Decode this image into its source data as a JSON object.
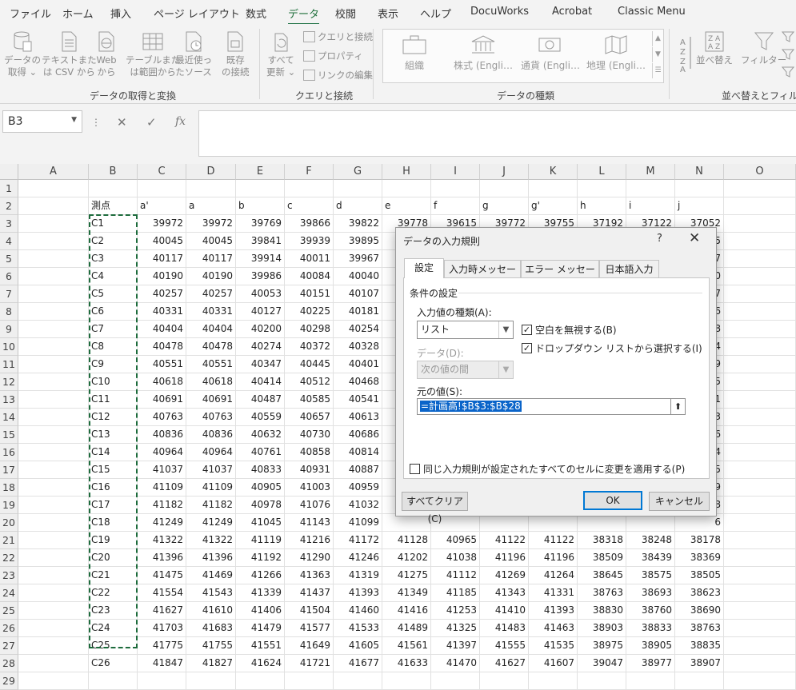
{
  "tabs": [
    "ファイル",
    "ホーム",
    "挿入",
    "ページ レイアウト",
    "数式",
    "データ",
    "校閲",
    "表示",
    "ヘルプ",
    "DocuWorks",
    "Acrobat",
    "Classic Menu"
  ],
  "ribbon": {
    "get_data": {
      "l1": "データの",
      "l2": "取得 ⌄"
    },
    "from_text_csv": {
      "l1": "テキストまた",
      "l2": "は CSV から"
    },
    "from_web": {
      "l1": "Web",
      "l2": "から"
    },
    "from_table": {
      "l1": "テーブルまた",
      "l2": "は範囲から"
    },
    "recent_sources": {
      "l1": "最近使っ",
      "l2": "たソース"
    },
    "existing_connections": {
      "l1": "既存",
      "l2": "の接続"
    },
    "group_get_transform": "データの取得と変換",
    "refresh_all": {
      "l1": "すべて",
      "l2": "更新 ⌄"
    },
    "queries_connections": "クエリと接続",
    "properties": "プロパティ",
    "edit_links": "リンクの編集",
    "group_queries": "クエリと接続",
    "data_types": [
      "組織",
      "株式 (Engli…",
      "通貨 (Engli…",
      "地理 (Engli…"
    ],
    "group_data_types": "データの種類",
    "sort": "並べ替え",
    "filter": "フィルター",
    "group_sort_filter": "並べ替えとフィルター"
  },
  "name_box": "B3",
  "formula_icons": {
    "cancel": "✕",
    "enter": "✓",
    "fx": "fx"
  },
  "columns": [
    "A",
    "B",
    "C",
    "D",
    "E",
    "F",
    "G",
    "H",
    "I",
    "J",
    "K",
    "L",
    "M",
    "N",
    "O"
  ],
  "rows": [
    [
      "",
      "",
      "",
      "",
      "",
      "",
      "",
      "",
      "",
      "",
      "",
      "",
      "",
      "",
      ""
    ],
    [
      "",
      "測点",
      "a'",
      "a",
      "b",
      "c",
      "d",
      "e",
      "f",
      "g",
      "g'",
      "h",
      "i",
      "j",
      ""
    ],
    [
      "",
      "C1",
      "39972",
      "39972",
      "39769",
      "39866",
      "39822",
      "39778",
      "39615",
      "39772",
      "39755",
      "37192",
      "37122",
      "37052",
      ""
    ],
    [
      "",
      "C2",
      "40045",
      "40045",
      "39841",
      "39939",
      "39895",
      "",
      "",
      "",
      "",
      "",
      "",
      "5",
      ""
    ],
    [
      "",
      "C3",
      "40117",
      "40117",
      "39914",
      "40011",
      "39967",
      "",
      "",
      "",
      "",
      "",
      "",
      "7",
      ""
    ],
    [
      "",
      "C4",
      "40190",
      "40190",
      "39986",
      "40084",
      "40040",
      "",
      "",
      "",
      "",
      "",
      "",
      "0",
      ""
    ],
    [
      "",
      "C5",
      "40257",
      "40257",
      "40053",
      "40151",
      "40107",
      "",
      "",
      "",
      "",
      "",
      "",
      "7",
      ""
    ],
    [
      "",
      "C6",
      "40331",
      "40331",
      "40127",
      "40225",
      "40181",
      "",
      "",
      "",
      "",
      "",
      "",
      "6",
      ""
    ],
    [
      "",
      "C7",
      "40404",
      "40404",
      "40200",
      "40298",
      "40254",
      "",
      "",
      "",
      "",
      "",
      "",
      "8",
      ""
    ],
    [
      "",
      "C8",
      "40478",
      "40478",
      "40274",
      "40372",
      "40328",
      "",
      "",
      "",
      "",
      "",
      "",
      "4",
      ""
    ],
    [
      "",
      "C9",
      "40551",
      "40551",
      "40347",
      "40445",
      "40401",
      "",
      "",
      "",
      "",
      "",
      "",
      "9",
      ""
    ],
    [
      "",
      "C10",
      "40618",
      "40618",
      "40414",
      "40512",
      "40468",
      "",
      "",
      "",
      "",
      "",
      "",
      "5",
      ""
    ],
    [
      "",
      "C11",
      "40691",
      "40691",
      "40487",
      "40585",
      "40541",
      "",
      "",
      "",
      "",
      "",
      "",
      "1",
      ""
    ],
    [
      "",
      "C12",
      "40763",
      "40763",
      "40559",
      "40657",
      "40613",
      "",
      "",
      "",
      "",
      "",
      "",
      "3",
      ""
    ],
    [
      "",
      "C13",
      "40836",
      "40836",
      "40632",
      "40730",
      "40686",
      "",
      "",
      "",
      "",
      "",
      "",
      "6",
      ""
    ],
    [
      "",
      "C14",
      "40964",
      "40964",
      "40761",
      "40858",
      "40814",
      "",
      "",
      "",
      "",
      "",
      "",
      "4",
      ""
    ],
    [
      "",
      "C15",
      "41037",
      "41037",
      "40833",
      "40931",
      "40887",
      "",
      "",
      "",
      "",
      "",
      "",
      "5",
      ""
    ],
    [
      "",
      "C16",
      "41109",
      "41109",
      "40905",
      "41003",
      "40959",
      "",
      "",
      "",
      "",
      "",
      "",
      "9",
      ""
    ],
    [
      "",
      "C17",
      "41182",
      "41182",
      "40978",
      "41076",
      "41032",
      "",
      "",
      "",
      "",
      "",
      "",
      "8",
      ""
    ],
    [
      "",
      "C18",
      "41249",
      "41249",
      "41045",
      "41143",
      "41099",
      "",
      "",
      "",
      "",
      "",
      "",
      "6",
      ""
    ],
    [
      "",
      "C19",
      "41322",
      "41322",
      "41119",
      "41216",
      "41172",
      "41128",
      "40965",
      "41122",
      "41122",
      "38318",
      "38248",
      "38178",
      ""
    ],
    [
      "",
      "C20",
      "41396",
      "41396",
      "41192",
      "41290",
      "41246",
      "41202",
      "41038",
      "41196",
      "41196",
      "38509",
      "38439",
      "38369",
      ""
    ],
    [
      "",
      "C21",
      "41475",
      "41469",
      "41266",
      "41363",
      "41319",
      "41275",
      "41112",
      "41269",
      "41264",
      "38645",
      "38575",
      "38505",
      ""
    ],
    [
      "",
      "C22",
      "41554",
      "41543",
      "41339",
      "41437",
      "41393",
      "41349",
      "41185",
      "41343",
      "41331",
      "38763",
      "38693",
      "38623",
      ""
    ],
    [
      "",
      "C23",
      "41627",
      "41610",
      "41406",
      "41504",
      "41460",
      "41416",
      "41253",
      "41410",
      "41393",
      "38830",
      "38760",
      "38690",
      ""
    ],
    [
      "",
      "C24",
      "41703",
      "41683",
      "41479",
      "41577",
      "41533",
      "41489",
      "41325",
      "41483",
      "41463",
      "38903",
      "38833",
      "38763",
      ""
    ],
    [
      "",
      "C25",
      "41775",
      "41755",
      "41551",
      "41649",
      "41605",
      "41561",
      "41397",
      "41555",
      "41535",
      "38975",
      "38905",
      "38835",
      ""
    ],
    [
      "",
      "C26",
      "41847",
      "41827",
      "41624",
      "41721",
      "41677",
      "41633",
      "41470",
      "41627",
      "41607",
      "39047",
      "38977",
      "38907",
      ""
    ],
    [
      "",
      "",
      "",
      "",
      "",
      "",
      "",
      "",
      "",
      "",
      "",
      "",
      "",
      "",
      ""
    ]
  ],
  "dialog": {
    "title": "データの入力規則",
    "help": "?",
    "close": "✕",
    "tabs": [
      "設定",
      "入力時メッセージ",
      "エラー メッセージ",
      "日本語入力"
    ],
    "section_label": "条件の設定",
    "allow_label": "入力値の種類(A):",
    "allow_value": "リスト",
    "ignore_blank": "空白を無視する(B)",
    "in_cell_dropdown": "ドロップダウン リストから選択する(I)",
    "data_label": "データ(D):",
    "data_value": "次の値の間",
    "source_label": "元の値(S):",
    "source_value": "=計画高!$B$3:$B$28",
    "apply_all": "同じ入力規則が設定されたすべてのセルに変更を適用する(P)",
    "clear_all": "すべてクリア(C)",
    "ok": "OK",
    "cancel": "キャンセル"
  }
}
